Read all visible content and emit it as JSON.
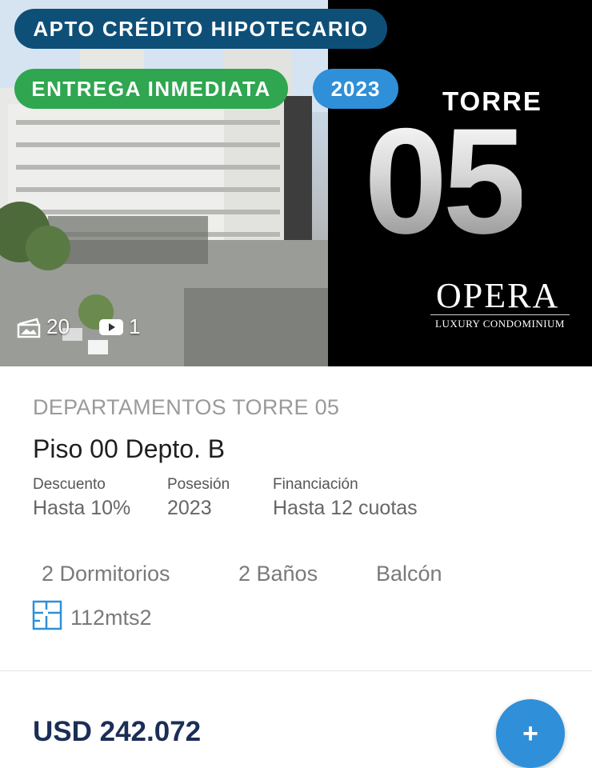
{
  "hero": {
    "badges": {
      "credit": "APTO CRÉDITO HIPOTECARIO",
      "delivery": "ENTREGA INMEDIATA",
      "year": "2023"
    },
    "tower_label": "TORRE",
    "tower_number": "05",
    "brand": {
      "name": "OPERA",
      "tagline": "LUXURY CONDOMINIUM"
    },
    "media": {
      "photos_count": "20",
      "videos_count": "1"
    }
  },
  "listing": {
    "category": "DEPARTAMENTOS TORRE 05",
    "title": "Piso 00 Depto. B",
    "details": [
      {
        "label": "Descuento",
        "value": "Hasta 10%"
      },
      {
        "label": "Posesión",
        "value": "2023"
      },
      {
        "label": "Financiación",
        "value": "Hasta 12 cuotas"
      }
    ],
    "features": [
      "2 Dormitorios",
      "2 Baños",
      "Balcón"
    ],
    "area": "112mts2",
    "price": "USD 242.072",
    "fab_label": "+"
  },
  "colors": {
    "credit_badge": "#0e4f78",
    "delivery_badge": "#2fa64f",
    "year_badge": "#2f8fd8",
    "price_text": "#1b2e57",
    "fab": "#2f8fd8"
  },
  "icons": {
    "photos": "photo-gallery-icon",
    "videos": "video-play-icon",
    "area": "floor-plan-icon"
  }
}
